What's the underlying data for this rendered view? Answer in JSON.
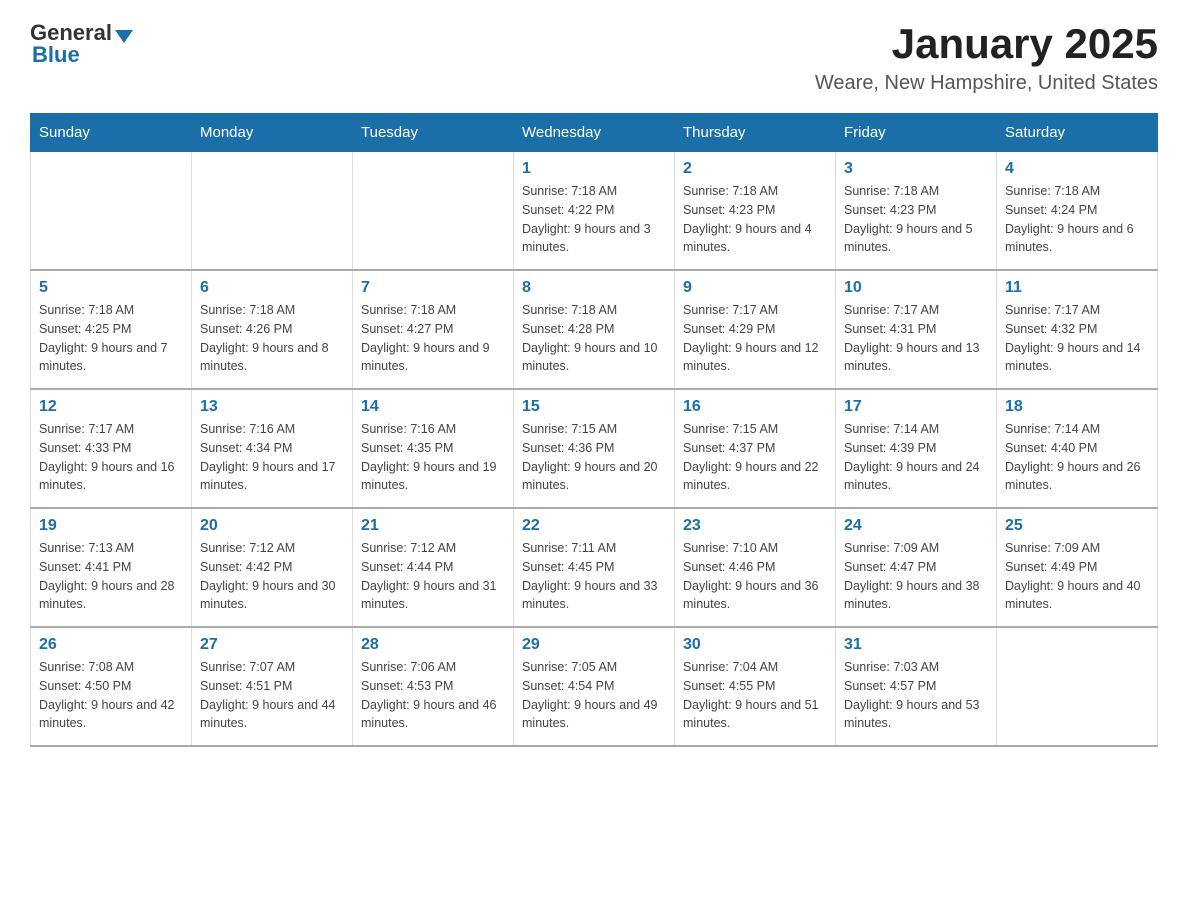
{
  "header": {
    "logo_general": "General",
    "logo_blue": "Blue",
    "title": "January 2025",
    "subtitle": "Weare, New Hampshire, United States"
  },
  "days_of_week": [
    "Sunday",
    "Monday",
    "Tuesday",
    "Wednesday",
    "Thursday",
    "Friday",
    "Saturday"
  ],
  "weeks": [
    [
      {
        "day": "",
        "info": ""
      },
      {
        "day": "",
        "info": ""
      },
      {
        "day": "",
        "info": ""
      },
      {
        "day": "1",
        "info": "Sunrise: 7:18 AM\nSunset: 4:22 PM\nDaylight: 9 hours and 3 minutes."
      },
      {
        "day": "2",
        "info": "Sunrise: 7:18 AM\nSunset: 4:23 PM\nDaylight: 9 hours and 4 minutes."
      },
      {
        "day": "3",
        "info": "Sunrise: 7:18 AM\nSunset: 4:23 PM\nDaylight: 9 hours and 5 minutes."
      },
      {
        "day": "4",
        "info": "Sunrise: 7:18 AM\nSunset: 4:24 PM\nDaylight: 9 hours and 6 minutes."
      }
    ],
    [
      {
        "day": "5",
        "info": "Sunrise: 7:18 AM\nSunset: 4:25 PM\nDaylight: 9 hours and 7 minutes."
      },
      {
        "day": "6",
        "info": "Sunrise: 7:18 AM\nSunset: 4:26 PM\nDaylight: 9 hours and 8 minutes."
      },
      {
        "day": "7",
        "info": "Sunrise: 7:18 AM\nSunset: 4:27 PM\nDaylight: 9 hours and 9 minutes."
      },
      {
        "day": "8",
        "info": "Sunrise: 7:18 AM\nSunset: 4:28 PM\nDaylight: 9 hours and 10 minutes."
      },
      {
        "day": "9",
        "info": "Sunrise: 7:17 AM\nSunset: 4:29 PM\nDaylight: 9 hours and 12 minutes."
      },
      {
        "day": "10",
        "info": "Sunrise: 7:17 AM\nSunset: 4:31 PM\nDaylight: 9 hours and 13 minutes."
      },
      {
        "day": "11",
        "info": "Sunrise: 7:17 AM\nSunset: 4:32 PM\nDaylight: 9 hours and 14 minutes."
      }
    ],
    [
      {
        "day": "12",
        "info": "Sunrise: 7:17 AM\nSunset: 4:33 PM\nDaylight: 9 hours and 16 minutes."
      },
      {
        "day": "13",
        "info": "Sunrise: 7:16 AM\nSunset: 4:34 PM\nDaylight: 9 hours and 17 minutes."
      },
      {
        "day": "14",
        "info": "Sunrise: 7:16 AM\nSunset: 4:35 PM\nDaylight: 9 hours and 19 minutes."
      },
      {
        "day": "15",
        "info": "Sunrise: 7:15 AM\nSunset: 4:36 PM\nDaylight: 9 hours and 20 minutes."
      },
      {
        "day": "16",
        "info": "Sunrise: 7:15 AM\nSunset: 4:37 PM\nDaylight: 9 hours and 22 minutes."
      },
      {
        "day": "17",
        "info": "Sunrise: 7:14 AM\nSunset: 4:39 PM\nDaylight: 9 hours and 24 minutes."
      },
      {
        "day": "18",
        "info": "Sunrise: 7:14 AM\nSunset: 4:40 PM\nDaylight: 9 hours and 26 minutes."
      }
    ],
    [
      {
        "day": "19",
        "info": "Sunrise: 7:13 AM\nSunset: 4:41 PM\nDaylight: 9 hours and 28 minutes."
      },
      {
        "day": "20",
        "info": "Sunrise: 7:12 AM\nSunset: 4:42 PM\nDaylight: 9 hours and 30 minutes."
      },
      {
        "day": "21",
        "info": "Sunrise: 7:12 AM\nSunset: 4:44 PM\nDaylight: 9 hours and 31 minutes."
      },
      {
        "day": "22",
        "info": "Sunrise: 7:11 AM\nSunset: 4:45 PM\nDaylight: 9 hours and 33 minutes."
      },
      {
        "day": "23",
        "info": "Sunrise: 7:10 AM\nSunset: 4:46 PM\nDaylight: 9 hours and 36 minutes."
      },
      {
        "day": "24",
        "info": "Sunrise: 7:09 AM\nSunset: 4:47 PM\nDaylight: 9 hours and 38 minutes."
      },
      {
        "day": "25",
        "info": "Sunrise: 7:09 AM\nSunset: 4:49 PM\nDaylight: 9 hours and 40 minutes."
      }
    ],
    [
      {
        "day": "26",
        "info": "Sunrise: 7:08 AM\nSunset: 4:50 PM\nDaylight: 9 hours and 42 minutes."
      },
      {
        "day": "27",
        "info": "Sunrise: 7:07 AM\nSunset: 4:51 PM\nDaylight: 9 hours and 44 minutes."
      },
      {
        "day": "28",
        "info": "Sunrise: 7:06 AM\nSunset: 4:53 PM\nDaylight: 9 hours and 46 minutes."
      },
      {
        "day": "29",
        "info": "Sunrise: 7:05 AM\nSunset: 4:54 PM\nDaylight: 9 hours and 49 minutes."
      },
      {
        "day": "30",
        "info": "Sunrise: 7:04 AM\nSunset: 4:55 PM\nDaylight: 9 hours and 51 minutes."
      },
      {
        "day": "31",
        "info": "Sunrise: 7:03 AM\nSunset: 4:57 PM\nDaylight: 9 hours and 53 minutes."
      },
      {
        "day": "",
        "info": ""
      }
    ]
  ]
}
